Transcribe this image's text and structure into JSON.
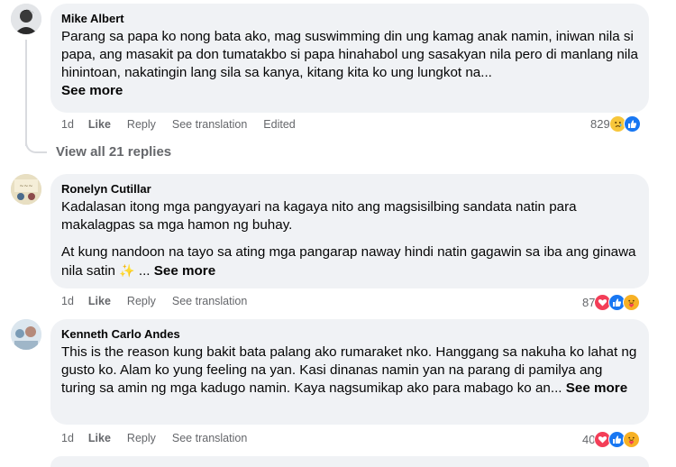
{
  "comments": [
    {
      "author": "Mike Albert",
      "text_lines": [
        "Parang sa papa ko nong bata ako, mag suswimming din ung kamag anak namin, iniwan nila si papa, ang masakit pa don tumatakbo si papa hinahabol ung sasakyan nila pero di manlang nila hinintoan, nakatingin lang sila sa kanya, kitang kita ko ung lungkot na..."
      ],
      "see_more": "See more",
      "time": "1d",
      "like": "Like",
      "reply": "Reply",
      "translate": "See translation",
      "edited": "Edited",
      "reaction_count": "829",
      "reactions": [
        "sad-reaction-icon",
        "like-reaction-icon"
      ]
    },
    {
      "author": "Ronelyn Cutillar",
      "paragraph1": "Kadalasan itong mga pangyayari na kagaya nito ang magsisilbing sandata natin para makalagpas sa mga hamon ng buhay.",
      "paragraph2": "At kung nandoon na tayo sa ating mga pangarap naway hindi natin gagawin sa iba ang ginawa nila satin",
      "sparkle": "✨",
      "ellipsis": "...",
      "see_more": "See more",
      "time": "1d",
      "like": "Like",
      "reply": "Reply",
      "translate": "See translation",
      "reaction_count": "87",
      "reactions": [
        "love-reaction-icon",
        "like-reaction-icon",
        "care-reaction-icon"
      ]
    },
    {
      "author": "Kenneth Carlo Andes",
      "text": "This is the reason kung bakit bata palang ako rumaraket nko. Hanggang sa nakuha ko lahat ng gusto ko. Alam ko yung feeling na yan. Kasi dinanas namin yan na parang di pamilya ang turing sa amin ng mga kadugo namin. Kaya nagsumikap ako para mabago ko an...",
      "see_more": "See more",
      "time": "1d",
      "like": "Like",
      "reply": "Reply",
      "translate": "See translation",
      "reaction_count": "40",
      "reactions": [
        "love-reaction-icon",
        "like-reaction-icon",
        "care-reaction-icon"
      ]
    }
  ],
  "view_replies": "View all 21 replies"
}
